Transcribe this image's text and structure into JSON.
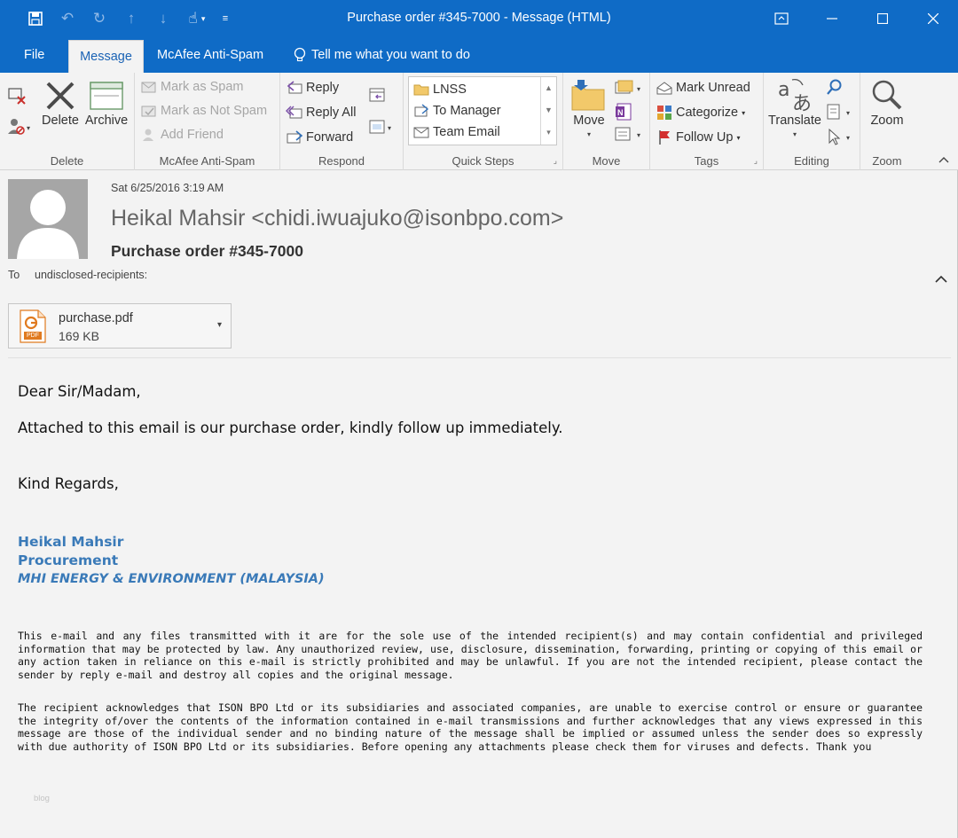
{
  "window": {
    "title": "Purchase order #345-7000 - Message (HTML)"
  },
  "tabs": [
    {
      "label": "File",
      "active": false
    },
    {
      "label": "Message",
      "active": true
    },
    {
      "label": "McAfee Anti-Spam",
      "active": false
    },
    {
      "label": "Tell me what you want to do",
      "active": false
    }
  ],
  "ribbon": {
    "delete_group": {
      "label": "Delete",
      "delete": "Delete",
      "archive": "Archive"
    },
    "mcafee_group": {
      "label": "McAfee Anti-Spam",
      "mark_spam": "Mark as Spam",
      "mark_not_spam": "Mark as Not Spam",
      "add_friend": "Add Friend"
    },
    "respond_group": {
      "label": "Respond",
      "reply": "Reply",
      "reply_all": "Reply All",
      "forward": "Forward"
    },
    "quicksteps_group": {
      "label": "Quick Steps",
      "items": [
        "LNSS",
        "To Manager",
        "Team Email"
      ]
    },
    "move_group": {
      "label": "Move",
      "move": "Move"
    },
    "tags_group": {
      "label": "Tags",
      "mark_unread": "Mark Unread",
      "categorize": "Categorize",
      "follow_up": "Follow Up"
    },
    "editing_group": {
      "label": "Editing",
      "translate": "Translate"
    },
    "zoom_group": {
      "label": "Zoom",
      "zoom": "Zoom"
    }
  },
  "header": {
    "date": "Sat 6/25/2016 3:19 AM",
    "sender": "Heikal Mahsir <chidi.iwuajuko@isonbpo.com>",
    "subject": "Purchase order #345-7000",
    "to_label": "To",
    "to_value": "undisclosed-recipients:"
  },
  "attachment": {
    "name": "purchase.pdf",
    "size": "169 KB",
    "icon_label": "PDF"
  },
  "body": {
    "greeting": "Dear Sir/Madam,",
    "line1": "Attached to this email is our purchase order, kindly follow up immediately.",
    "closing": "Kind Regards,",
    "sig_name": "Heikal Mahsir",
    "sig_title": "Procurement",
    "sig_company": "MHI ENERGY & ENVIRONMENT (MALAYSIA)",
    "disclaimer1": "This e-mail and any files transmitted with it are for the sole use of the intended recipient(s) and may contain confidential and privileged information that may be protected by law. Any unauthorized review, use, disclosure, dissemination, forwarding, printing or copying of this email or any action taken in reliance on this e-mail is strictly prohibited and may be unlawful. If you are not the intended recipient, please contact the sender by reply e-mail and destroy all copies and the original message.",
    "disclaimer2": "The recipient acknowledges that ISON BPO Ltd  or its subsidiaries and associated companies, are unable to exercise control or ensure or guarantee the integrity of/over the contents of the information contained in e-mail transmissions and further acknowledges that any views expressed in this message are those of the individual sender and no binding nature of the message shall be implied or assumed unless the sender does so expressly with due authority of ISON BPO Ltd  or its subsidiaries. Before opening any attachments please check them for viruses and defects. Thank you",
    "watermark": "blog"
  }
}
